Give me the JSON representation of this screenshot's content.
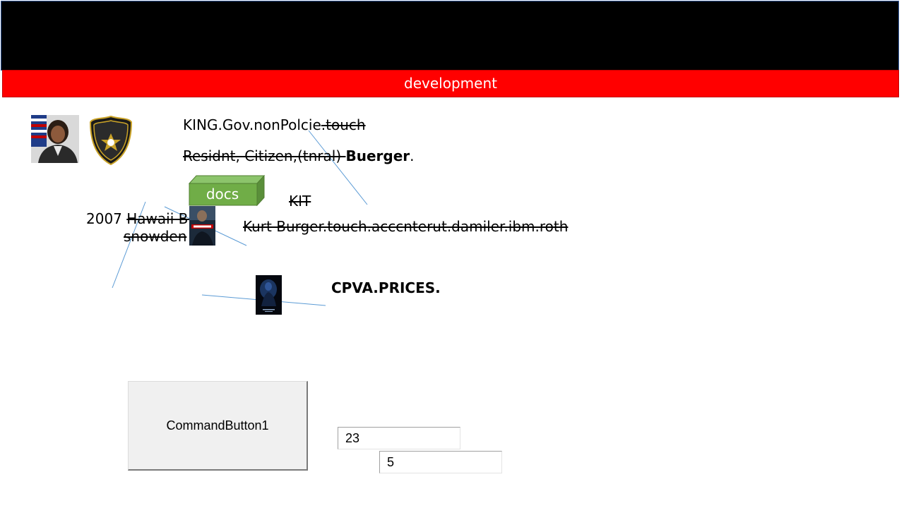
{
  "banner": {
    "label": "development"
  },
  "texts": {
    "line1_plain": "KING.Gov.nonPolcie",
    "line1_struck": ".touch",
    "line2_struck": "Residnt, Citizen,(tnral) ",
    "line2_bold": "Buerger",
    "line2_tail": ".",
    "docs_label": "docs",
    "kit": "KIT",
    "year": "2007 ",
    "hawaii": "Hawaii Bm",
    "snowden": "snowden",
    "kurt": "Kurt Burger.touch.acccnterut.damiler.ibm.roth",
    "cpva": "CPVA.PRICES."
  },
  "controls": {
    "command_button_label": "CommandButton1",
    "textbox1_value": "23",
    "textbox2_value": "5"
  },
  "colors": {
    "top_bar": "#000000",
    "banner": "#ff0000",
    "docs_box": "#70ad47",
    "connector_lines": "#5b9bd5"
  },
  "icons": {
    "photo": "portrait-photo-icon",
    "badge": "sheriff-badge-icon",
    "poster1": "movie-poster-icon",
    "poster2": "movie-poster-icon"
  }
}
